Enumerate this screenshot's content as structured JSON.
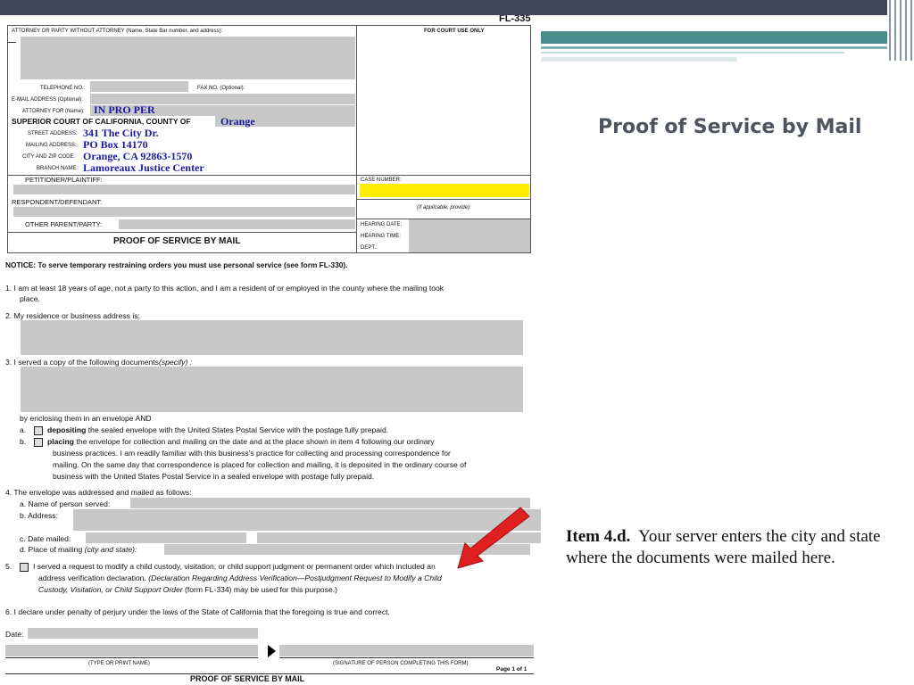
{
  "slide": {
    "title": "Proof of Service by Mail",
    "caption_bold": "Item 4.d.",
    "caption_text": "Your server enters the city and state where the documents were mailed here.",
    "accent_color": "#4a8c8c",
    "arrow_color": "#e02020"
  },
  "form": {
    "form_number": "FL-335",
    "attorney_header": "ATTORNEY OR PARTY WITHOUT ATTORNEY (Name, State Bar number, and address):",
    "court_use": "FOR COURT USE ONLY",
    "telephone": "TELEPHONE NO.:",
    "fax": "FAX NO. (Optional):",
    "email": "E-MAIL ADDRESS (Optional):",
    "attorney_for": "ATTORNEY FOR (Name):",
    "attorney_for_value": "IN PRO PER",
    "court_label": "SUPERIOR COURT OF CALIFORNIA, COUNTY OF",
    "county_value": "Orange",
    "street_label": "STREET ADDRESS:",
    "street_value": "341 The City Dr.",
    "mailing_label": "MAILING ADDRESS:",
    "mailing_value": "PO Box 14170",
    "cityzip_label": "CITY AND ZIP CODE:",
    "cityzip_value": "Orange, CA  92863-1570",
    "branch_label": "BRANCH NAME:",
    "branch_value": "Lamoreaux Justice Center",
    "petitioner": "PETITIONER/PLAINTIFF:",
    "respondent": "RESPONDENT/DEFENDANT:",
    "other_parent": "OTHER PARENT/PARTY:",
    "doc_title": "PROOF OF SERVICE BY MAIL",
    "case_number": "CASE NUMBER:",
    "if_applicable": "(If applicable, provide):",
    "hearing_date": "HEARING DATE:",
    "hearing_time": "HEARING TIME:",
    "dept": "DEPT.:",
    "notice": "NOTICE: To serve temporary restraining orders you must use personal service (see form FL-330).",
    "item1": "1.   I am at least 18 years of age, not a party to this action, and I am a resident of or employed in the county where the mailing took",
    "item1b": "place.",
    "item2": "2.   My residence or business address is:",
    "item3": "3.   I served a copy of the following documents",
    "item3_specify": "(specify) :",
    "enclosing": "by enclosing them in an envelope AND",
    "item_a_label": "a.",
    "item_a_bold": "depositing",
    "item_a_text": "the sealed envelope with the United States Postal Service with the postage fully prepaid.",
    "item_b_label": "b.",
    "item_b_bold": "placing",
    "item_b_text1": "the envelope for collection and mailing on the date and at the place shown in item 4 following our ordinary",
    "item_b_text2": "business practices. I am readily familiar with this business's practice for collecting and processing correspondence for",
    "item_b_text3": "mailing. On the same day that correspondence is placed for collection and mailing, it is deposited in the ordinary course of",
    "item_b_text4": "business with the United States Postal Service in a sealed envelope with postage fully prepaid.",
    "item4": "4.   The envelope was addressed and mailed as follows:",
    "item4a": "a.   Name of person served:",
    "item4b": "b.   Address:",
    "item4c": "c.   Date mailed:",
    "item4d": "d.   Place of mailing",
    "item4d_italic": "(city and state):",
    "item5_num": "5.",
    "item5_text1": "I served a request to modify a child custody, visitation, or child support judgment or permanent order which included an",
    "item5_text2a": "address verification declaration.",
    "item5_text2b": "(Declaration Regarding Address Verification—Postjudgment Request to Modify a Child",
    "item5_text3a": "Custody, Visitation, or Child Support Order",
    "item5_text3b": "(form FL-334) may be used for this purpose.)",
    "item6": "6.   I declare under penalty of perjury under the laws of the State of California that the foregoing is true and correct.",
    "date_label": "Date:",
    "type_name": "(TYPE OR PRINT NAME)",
    "signature": "(SIGNATURE OF PERSON COMPLETING THIS FORM)",
    "page": "Page 1 of 1",
    "footer_title": "PROOF OF SERVICE BY MAIL"
  }
}
